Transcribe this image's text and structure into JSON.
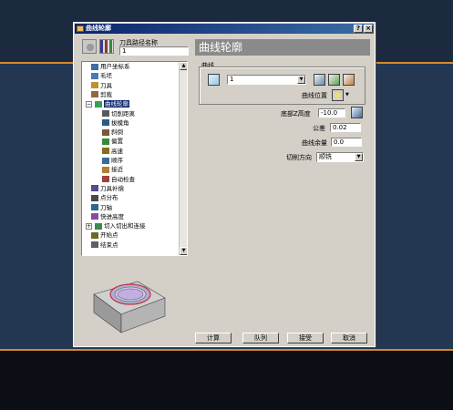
{
  "window": {
    "title": "曲线轮廓",
    "help_glyph": "?",
    "close_glyph": "×"
  },
  "header": {
    "name_label": "刀具路径名称",
    "name_value": "1",
    "strategy_title": "曲线轮廓"
  },
  "tree": {
    "items": [
      {
        "label": "用户坐标系",
        "icon": "ucs-icon"
      },
      {
        "label": "毛坯",
        "icon": "block-icon"
      },
      {
        "label": "刀具",
        "icon": "tool-icon"
      },
      {
        "label": "剪裁",
        "icon": "trim-icon"
      },
      {
        "label": "曲线轮廓",
        "icon": "curve-profile-icon",
        "selected": true,
        "expander": "−"
      },
      {
        "label": "切削距离",
        "icon": "cut-distance-icon"
      },
      {
        "label": "拔模角",
        "icon": "draft-angle-icon"
      },
      {
        "label": "斜倒",
        "icon": "chamfer-icon"
      },
      {
        "label": "偏置",
        "icon": "offset-icon"
      },
      {
        "label": "高速",
        "icon": "high-speed-icon"
      },
      {
        "label": "顺序",
        "icon": "order-icon"
      },
      {
        "label": "接近",
        "icon": "approach-icon"
      },
      {
        "label": "自动检查",
        "icon": "auto-check-icon"
      },
      {
        "label": "刀具补偿",
        "icon": "tool-comp-icon"
      },
      {
        "label": "点分布",
        "icon": "point-dist-icon"
      },
      {
        "label": "刀轴",
        "icon": "tool-axis-icon"
      },
      {
        "label": "快进高度",
        "icon": "rapid-height-icon"
      },
      {
        "label": "切入切出和连接",
        "icon": "leads-links-icon",
        "expander": "+"
      },
      {
        "label": "开始点",
        "icon": "start-point-icon"
      },
      {
        "label": "结束点",
        "icon": "end-point-icon"
      }
    ]
  },
  "form": {
    "curve_group_label": "曲线",
    "curve_value": "1",
    "curve_position_label": "曲线位置",
    "base_height_label": "底部Z高度",
    "base_height_value": "-10.0",
    "tolerance_label": "公差",
    "tolerance_value": "0.02",
    "curve_thickness_label": "曲线余量",
    "curve_thickness_value": "0.0",
    "cut_direction_label": "切削方向",
    "cut_direction_value": "顺铣",
    "dropdown_glyph": "▼"
  },
  "buttons": {
    "calculate": "计算",
    "queue": "队列",
    "accept": "接受",
    "cancel": "取消"
  },
  "scrollbar": {
    "up_glyph": "▲",
    "down_glyph": "▼"
  }
}
